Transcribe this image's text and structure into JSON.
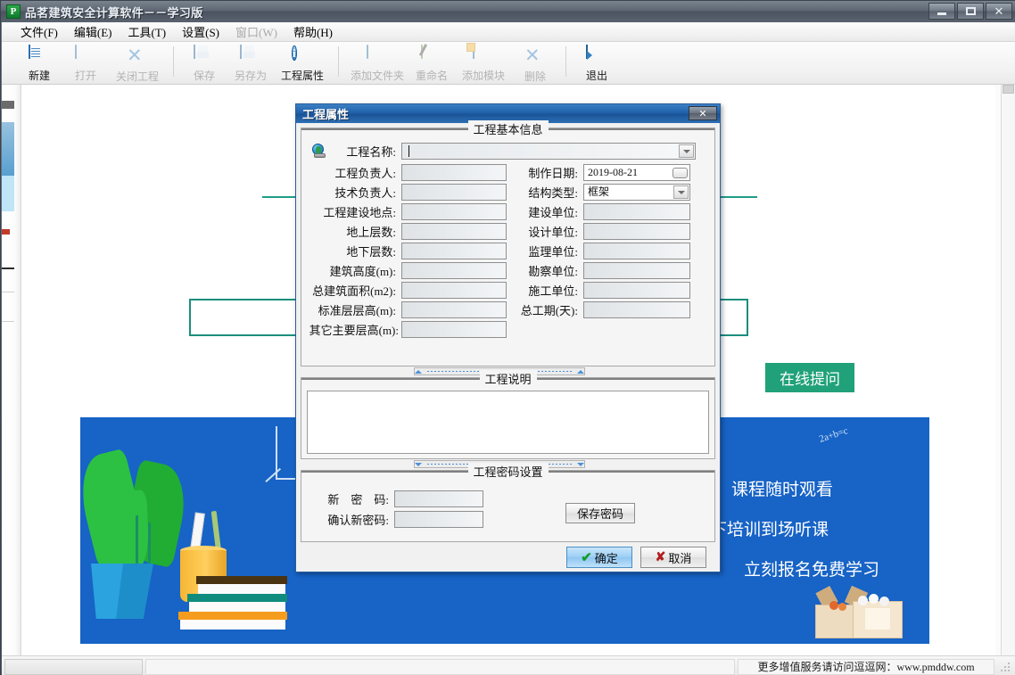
{
  "window": {
    "title": "品茗建筑安全计算软件－－学习版",
    "icon": "app-logo-icon",
    "buttons": {
      "minimize": "–",
      "maximize": "□",
      "close": "✕"
    }
  },
  "menubar": {
    "items": [
      {
        "label": "文件(F)",
        "enabled": true
      },
      {
        "label": "编辑(E)",
        "enabled": true
      },
      {
        "label": "工具(T)",
        "enabled": true
      },
      {
        "label": "设置(S)",
        "enabled": true
      },
      {
        "label": "窗口(W)",
        "enabled": false
      },
      {
        "label": "帮助(H)",
        "enabled": true
      }
    ]
  },
  "toolbar": {
    "items": [
      {
        "label": "新建",
        "icon": "new-document-icon",
        "enabled": true
      },
      {
        "label": "打开",
        "icon": "open-folder-icon",
        "enabled": false
      },
      {
        "label": "关闭工程",
        "icon": "close-project-icon",
        "enabled": false
      },
      {
        "label": "保存",
        "icon": "save-icon",
        "enabled": false
      },
      {
        "label": "另存为",
        "icon": "save-as-icon",
        "enabled": false
      },
      {
        "label": "工程属性",
        "icon": "info-icon",
        "enabled": true
      },
      {
        "label": "添加文件夹",
        "icon": "add-folder-icon",
        "enabled": false
      },
      {
        "label": "重命名",
        "icon": "rename-icon",
        "enabled": false
      },
      {
        "label": "添加模块",
        "icon": "add-module-icon",
        "enabled": false
      },
      {
        "label": "删除",
        "icon": "delete-icon",
        "enabled": false
      },
      {
        "label": "退出",
        "icon": "exit-icon",
        "enabled": true
      }
    ]
  },
  "background": {
    "online_help_button": "在线提问",
    "banner": {
      "line1": "课程随时观看",
      "line2": "下培训到场听课",
      "line3": "立刻报名免费学习",
      "chalk_formula": "2a+b=c",
      "background_color": "#1763c6"
    }
  },
  "statusbar": {
    "left": "",
    "right": "更多增值服务请访问逗逗网：www.pmddw.com"
  },
  "dialog": {
    "title": "工程属性",
    "close_label": "✕",
    "groups": {
      "basic": {
        "caption": "工程基本信息",
        "left_fields": [
          {
            "label": "工程名称:",
            "value": "",
            "type": "combo",
            "focused": true
          },
          {
            "label": "工程负责人:",
            "value": "",
            "type": "text"
          },
          {
            "label": "技术负责人:",
            "value": "",
            "type": "text"
          },
          {
            "label": "工程建设地点:",
            "value": "",
            "type": "text"
          },
          {
            "label": "地上层数:",
            "value": "",
            "type": "text"
          },
          {
            "label": "地下层数:",
            "value": "",
            "type": "text"
          },
          {
            "label": "建筑高度(m):",
            "value": "",
            "type": "text"
          },
          {
            "label": "总建筑面积(m2):",
            "value": "",
            "type": "text"
          },
          {
            "label": "标准层层高(m):",
            "value": "",
            "type": "text"
          },
          {
            "label": "其它主要层高(m):",
            "value": "",
            "type": "text"
          }
        ],
        "right_fields": [
          {
            "label": "制作日期:",
            "value": "2019-08-21",
            "type": "date"
          },
          {
            "label": "结构类型:",
            "value": "框架",
            "type": "combo"
          },
          {
            "label": "建设单位:",
            "value": "",
            "type": "text"
          },
          {
            "label": "设计单位:",
            "value": "",
            "type": "text"
          },
          {
            "label": "监理单位:",
            "value": "",
            "type": "text"
          },
          {
            "label": "勘察单位:",
            "value": "",
            "type": "text"
          },
          {
            "label": "施工单位:",
            "value": "",
            "type": "text"
          },
          {
            "label": "总工期(天):",
            "value": "",
            "type": "text"
          }
        ],
        "globe_icon": "globe-web-icon"
      },
      "description": {
        "caption": "工程说明",
        "value": ""
      },
      "password": {
        "caption": "工程密码设置",
        "new_password_label": "新　密　码:",
        "new_password_value": "",
        "confirm_password_label": "确认新密码:",
        "confirm_password_value": "",
        "save_button": "保存密码"
      }
    },
    "actions": {
      "ok": "确定",
      "cancel": "取消"
    }
  }
}
